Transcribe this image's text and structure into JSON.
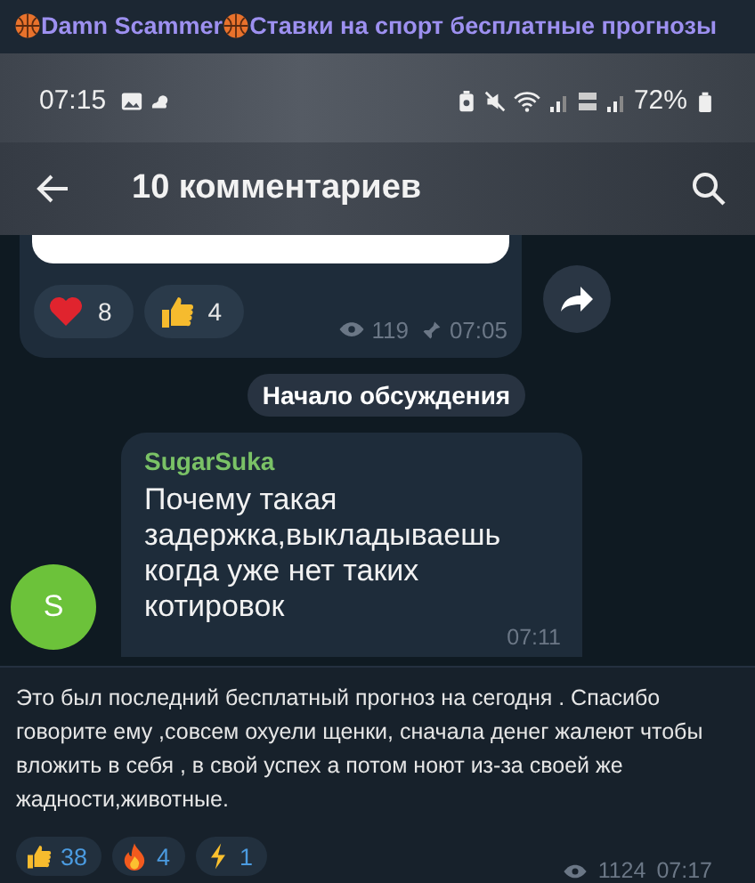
{
  "channel": {
    "title_parts": [
      "Damn Scammer",
      "Ставки на спорт бесплатные прогнозы"
    ]
  },
  "screenshot": {
    "status_bar": {
      "time": "07:15",
      "battery": "72%"
    },
    "app_bar": {
      "title": "10 комментариев"
    },
    "post": {
      "reactions": [
        {
          "kind": "heart",
          "count": "8"
        },
        {
          "kind": "thumbs_up",
          "count": "4"
        }
      ],
      "views": "119",
      "time": "07:05"
    },
    "service_message": "Начало обсуждения",
    "comment": {
      "author": "SugarSuka",
      "avatar": "S",
      "text": "Почему такая задержка,выкладываешь когда уже нет таких котировок",
      "time": "07:11"
    }
  },
  "caption": "Это был последний бесплатный прогноз на сегодня . Спасибо говорите ему ,совсем охуели щенки, сначала денег жалеют чтобы вложить в себя , в свой успех а потом ноют из-за своей же жадности,животные.",
  "reactions": [
    {
      "kind": "thumbs_up",
      "count": "38"
    },
    {
      "kind": "fire",
      "count": "4"
    },
    {
      "kind": "zap",
      "count": "1"
    }
  ],
  "views": "1124",
  "time": "07:17"
}
